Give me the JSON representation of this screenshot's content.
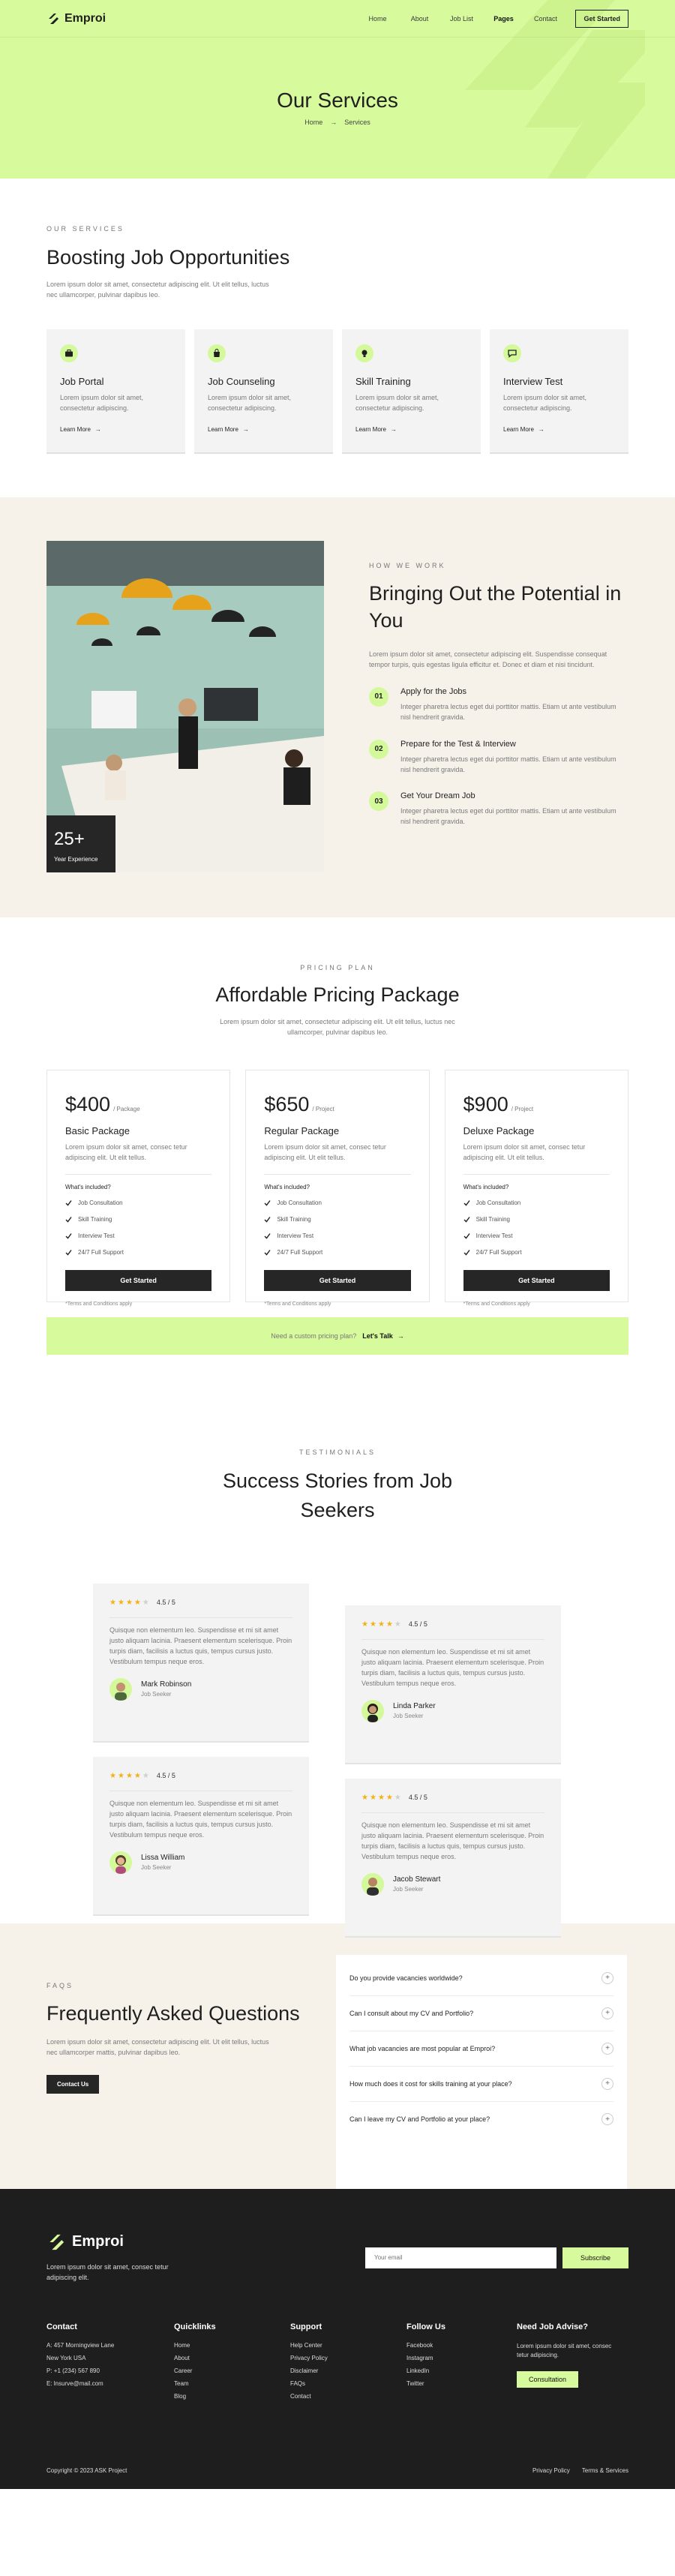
{
  "brand": {
    "name": "Emproi",
    "accent": "#d7fa9c",
    "dark": "#262626",
    "cream": "#f6f2ea"
  },
  "nav": {
    "links": [
      "Home",
      "About",
      "Job List",
      "Pages",
      "Contact"
    ],
    "active": "Pages",
    "cta": "Get Started"
  },
  "hero": {
    "title": "Our Services",
    "crumb_home": "Home",
    "crumb_sep": "→",
    "crumb_current": "Services"
  },
  "services": {
    "eyebrow": "OUR SERVICES",
    "title": "Boosting Job Opportunities",
    "intro": "Lorem ipsum dolor sit amet, consectetur adipiscing elit. Ut elit tellus, luctus nec ullamcorper, pulvinar dapibus leo.",
    "cards": [
      {
        "icon": "briefcase-icon",
        "title": "Job Portal",
        "text": "Lorem ipsum dolor sit amet, consectetur adipiscing.",
        "link": "Learn More"
      },
      {
        "icon": "bag-icon",
        "title": "Job Counseling",
        "text": "Lorem ipsum dolor sit amet, consectetur adipiscing.",
        "link": "Learn More"
      },
      {
        "icon": "lightbulb-icon",
        "title": "Skill Training",
        "text": "Lorem ipsum dolor sit amet, consectetur adipiscing.",
        "link": "Learn More"
      },
      {
        "icon": "chat-icon",
        "title": "Interview Test",
        "text": "Lorem ipsum dolor sit amet, consectetur adipiscing.",
        "link": "Learn More"
      }
    ]
  },
  "how": {
    "eyebrow": "HOW WE WORK",
    "title": "Bringing Out the Potential in You",
    "intro": "Lorem ipsum dolor sit amet, consectetur adipiscing elit. Suspendisse consequat tempor turpis, quis egestas ligula efficitur et. Donec et diam et nisi tincidunt.",
    "experience_num": "25+",
    "experience_label": "Year Experience",
    "steps": [
      {
        "num": "01",
        "title": "Apply for the Jobs",
        "text": "Integer pharetra lectus eget dui porttitor mattis. Etiam ut ante vestibulum nisl hendrerit gravida."
      },
      {
        "num": "02",
        "title": "Prepare for the Test & Interview",
        "text": "Integer pharetra lectus eget dui porttitor mattis. Etiam ut ante vestibulum nisl hendrerit gravida."
      },
      {
        "num": "03",
        "title": "Get Your Dream Job",
        "text": "Integer pharetra lectus eget dui porttitor mattis. Etiam ut ante vestibulum nisl hendrerit gravida."
      }
    ]
  },
  "pricing": {
    "eyebrow": "PRICING PLAN",
    "title": "Affordable Pricing Package",
    "intro": "Lorem ipsum dolor sit amet, consectetur adipiscing elit. Ut elit tellus, luctus nec ullamcorper, pulvinar dapibus leo.",
    "included_label": "What's included?",
    "button": "Get Started",
    "terms": "*Terms and Conditions apply",
    "plans": [
      {
        "price": "$400",
        "unit": "/ Package",
        "name": "Basic Package",
        "desc": "Lorem ipsum dolor sit amet, consec tetur adipiscing elit. Ut elit tellus.",
        "features": [
          "Job Consultation",
          "Skill Training",
          "Interview Test",
          "24/7 Full Support"
        ]
      },
      {
        "price": "$650",
        "unit": "/ Project",
        "name": "Regular Package",
        "desc": "Lorem ipsum dolor sit amet, consec tetur adipiscing elit. Ut elit tellus.",
        "features": [
          "Job Consultation",
          "Skill Training",
          "Interview Test",
          "24/7 Full Support"
        ]
      },
      {
        "price": "$900",
        "unit": "/ Project",
        "name": "Deluxe Package",
        "desc": "Lorem ipsum dolor sit amet, consec tetur adipiscing elit. Ut elit tellus.",
        "features": [
          "Job Consultation",
          "Skill Training",
          "Interview Test",
          "24/7 Full Support"
        ]
      }
    ],
    "custom_question": "Need a custom pricing plan?",
    "custom_link": "Let's Talk"
  },
  "testimonials": {
    "eyebrow": "TESTIMONIALS",
    "title": "Success Stories from Job Seekers",
    "items": [
      {
        "stars": 4.5,
        "rating": "4.5 / 5",
        "text": "Quisque non elementum leo. Suspendisse et mi sit amet justo aliquam lacinia. Praesent elementum scelerisque. Proin turpis diam, facilisis a luctus quis, tempus cursus justo. Vestibulum tempus neque eros.",
        "name": "Mark Robinson",
        "role": "Job Seeker"
      },
      {
        "stars": 4.5,
        "rating": "4.5 / 5",
        "text": "Quisque non elementum leo. Suspendisse et mi sit amet justo aliquam lacinia. Praesent elementum scelerisque. Proin turpis diam, facilisis a luctus quis, tempus cursus justo. Vestibulum tempus neque eros.",
        "name": "Linda Parker",
        "role": "Job Seeker"
      },
      {
        "stars": 4.5,
        "rating": "4.5 / 5",
        "text": "Quisque non elementum leo. Suspendisse et mi sit amet justo aliquam lacinia. Praesent elementum scelerisque. Proin turpis diam, facilisis a luctus quis, tempus cursus justo. Vestibulum tempus neque eros.",
        "name": "Lissa William",
        "role": "Job Seeker"
      },
      {
        "stars": 4.5,
        "rating": "4.5 / 5",
        "text": "Quisque non elementum leo. Suspendisse et mi sit amet justo aliquam lacinia. Praesent elementum scelerisque. Proin turpis diam, facilisis a luctus quis, tempus cursus justo. Vestibulum tempus neque eros.",
        "name": "Jacob Stewart",
        "role": "Job Seeker"
      }
    ]
  },
  "faq": {
    "eyebrow": "FAQS",
    "title": "Frequently Asked Questions",
    "intro": "Lorem ipsum dolor sit amet, consectetur adipiscing elit. Ut elit tellus, luctus nec ullamcorper mattis, pulvinar dapibus leo.",
    "button": "Contact Us",
    "questions": [
      "Do you provide vacancies worldwide?",
      "Can I consult about my CV and Portfolio?",
      "What job vacancies are most popular at Emproi?",
      "How much does it cost for skills training at your place?",
      "Can I leave my CV and Portfolio at your place?"
    ]
  },
  "footer": {
    "tagline": "Lorem ipsum dolor sit amet, consec tetur adipiscing elit.",
    "email_placeholder": "Your email",
    "subscribe": "Subscribe",
    "contact": {
      "heading": "Contact",
      "lines": [
        "A: 457 Morningview Lane",
        "New York USA",
        "P: +1 (234) 567 890",
        "E: lnsurve@mail.com"
      ]
    },
    "quicklinks": {
      "heading": "Quicklinks",
      "lines": [
        "Home",
        "About",
        "Career",
        "Team",
        "Blog"
      ]
    },
    "support": {
      "heading": "Support",
      "lines": [
        "Help Center",
        "Privacy Policy",
        "Disclaimer",
        "FAQs",
        "Contact"
      ]
    },
    "follow": {
      "heading": "Follow Us",
      "lines": [
        "Facebook",
        "Instagram",
        "LinkedIn",
        "Twitter"
      ]
    },
    "advise": {
      "heading": "Need Job Advise?",
      "text": "Lorem ipsum dolor sit amet, consec tetur adipiscing.",
      "button": "Consultation"
    },
    "copyright": "Copyright © 2023 ASK Project",
    "bottom_links": [
      "Privacy Policy",
      "Terms & Services"
    ]
  }
}
